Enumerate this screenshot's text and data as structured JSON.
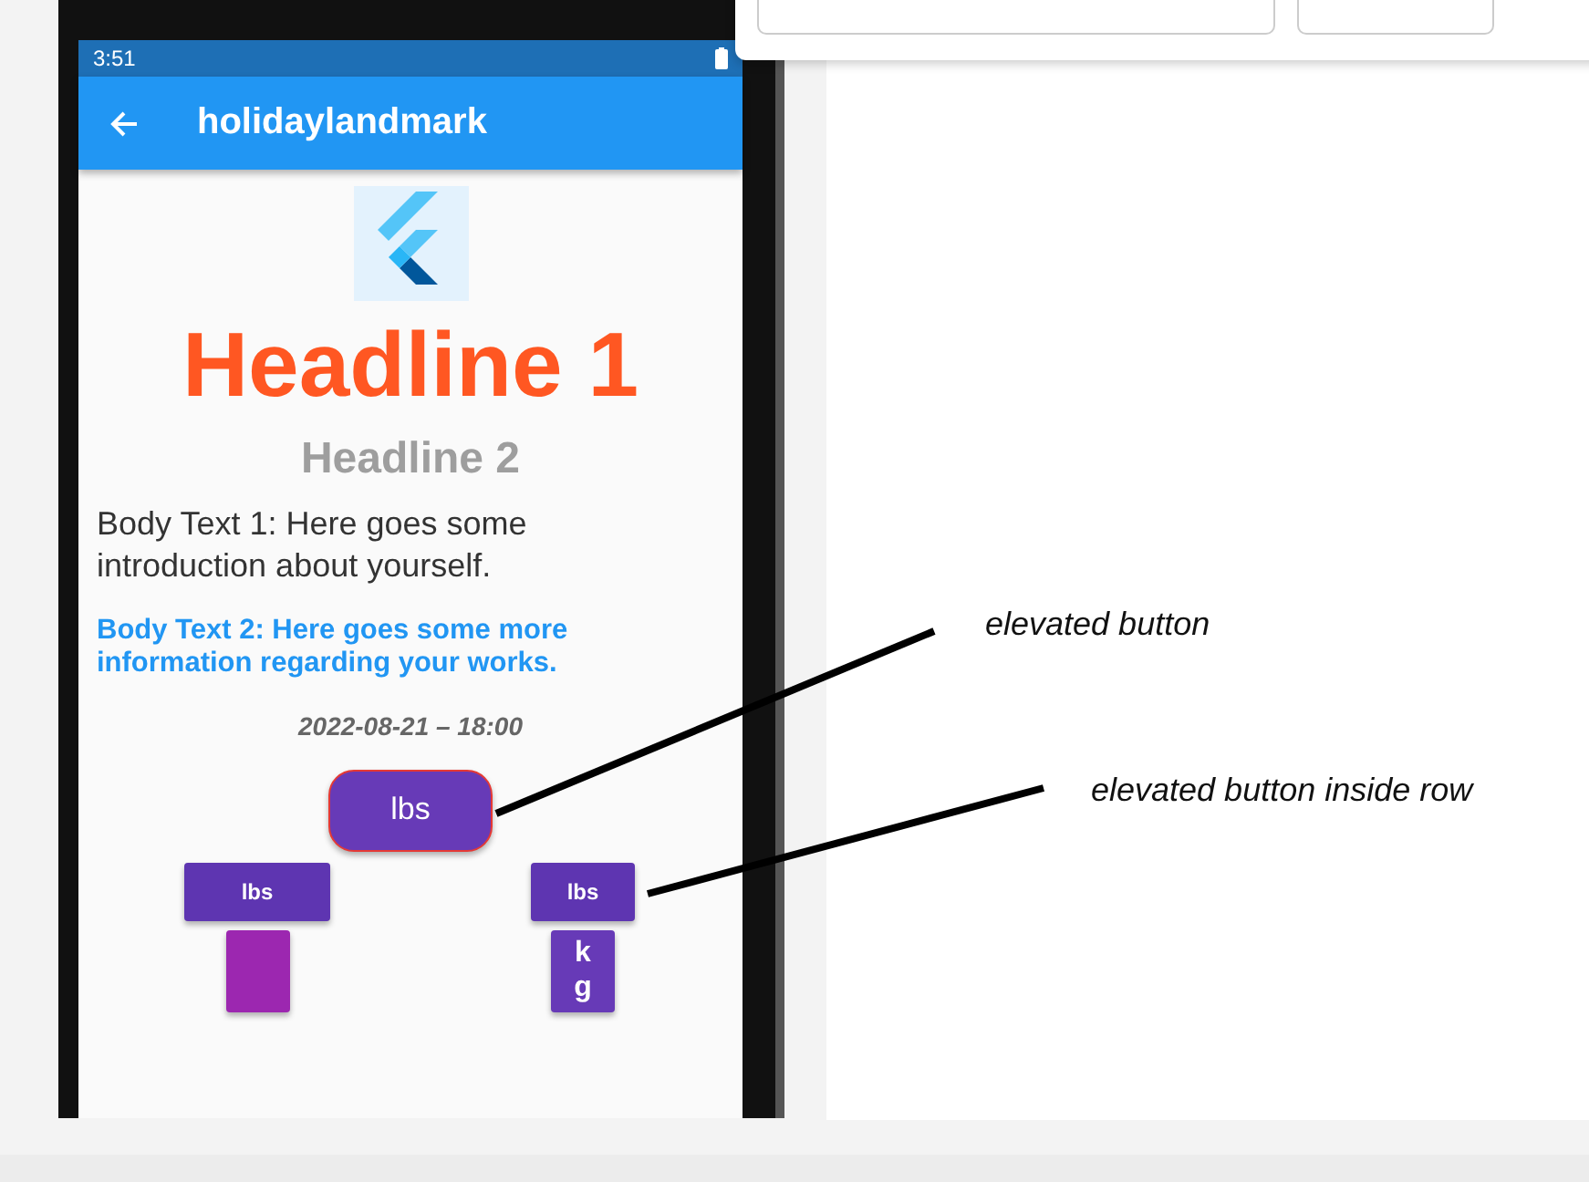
{
  "phone": {
    "status_bar": {
      "time": "3:51"
    },
    "app_bar": {
      "title": "holidaylandmark"
    },
    "headline_1": "Headline 1",
    "headline_2": "Headline 2",
    "body_text_1": "Body Text 1: Here goes some introduction about yourself.",
    "body_text_2": "Body Text 2: Here goes some more information regarding your works.",
    "timestamp": "2022-08-21 – 18:00",
    "elevated_button": {
      "label": "lbs"
    },
    "button_columns": [
      {
        "buttons": [
          {
            "kind": "wide",
            "label": "lbs",
            "color": "#5e35b1"
          },
          {
            "kind": "blank",
            "color": "#9c27b0"
          }
        ]
      },
      {
        "buttons": [
          {
            "kind": "wide",
            "label": "lbs",
            "color": "#5e35b1"
          },
          {
            "kind": "narrow",
            "label": "kg",
            "color": "#673ab7"
          }
        ]
      }
    ]
  },
  "annotations": [
    {
      "text": "elevated button"
    },
    {
      "text": "elevated button inside row"
    }
  ]
}
